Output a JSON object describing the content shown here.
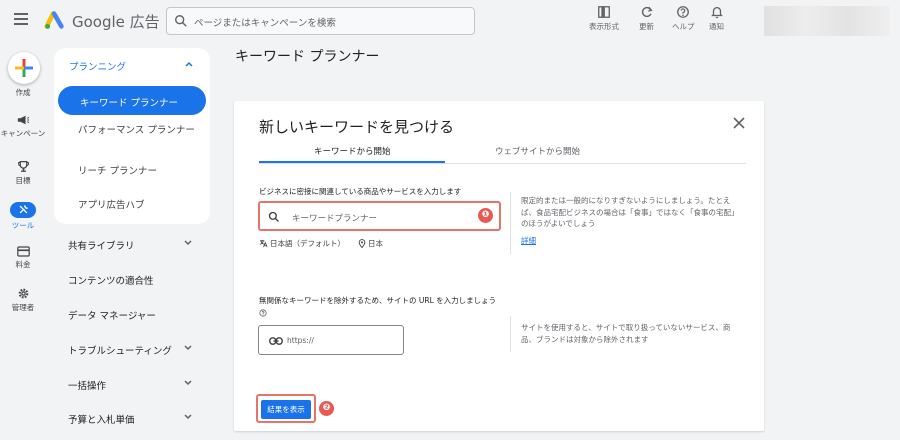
{
  "header": {
    "brand": "Google 広告",
    "search_placeholder": "ページまたはキャンペーンを検索",
    "tools": [
      {
        "label": "表示形式",
        "icon": "display-format-icon"
      },
      {
        "label": "更新",
        "icon": "refresh-icon"
      },
      {
        "label": "ヘルプ",
        "icon": "help-icon"
      },
      {
        "label": "通知",
        "icon": "bell-icon"
      }
    ]
  },
  "rail": {
    "create_label": "作成",
    "campaign_label": "キャンペーン",
    "goals_label": "目標",
    "tools_label": "ツール",
    "billing_label": "料金",
    "admin_label": "管理者"
  },
  "nav": {
    "planning_header": "プランニング",
    "items": [
      "キーワード プランナー",
      "パフォーマンス プランナー",
      "リーチ プランナー",
      "アプリ広告ハブ"
    ],
    "sections": [
      "共有ライブラリ",
      "コンテンツの適合性",
      "データ マネージャー",
      "トラブルシューティング",
      "一括操作",
      "予算と入札単価"
    ]
  },
  "page": {
    "title": "キーワード プランナー"
  },
  "card": {
    "title": "新しいキーワードを見つける",
    "tabs": [
      "キーワードから開始",
      "ウェブサイトから開始"
    ],
    "active_tab": 0,
    "keyword_label": "ビジネスに密接に関連している商品やサービスを入力します",
    "keyword_placeholder": "キーワードプランナー",
    "language": "日本語（デフォルト）",
    "location": "日本",
    "keyword_help": "限定的または一般的になりすぎないようにしましょう。たとえば、食品宅配ビジネスの場合は「食事」ではなく「食事の宅配」のほうがよいでしょう",
    "details_link": "詳細",
    "url_label": "無関係なキーワードを除外するため、サイトの URL を入力しましょう",
    "url_placeholder": "https://",
    "url_help": "サイトを使用すると、サイトで取り扱っていないサービス、商品、ブランドは対象から除外されます",
    "submit_label": "結果を表示"
  },
  "annotations": {
    "badge1": "❶",
    "badge2": "❷"
  },
  "colors": {
    "accent": "#1a73e8",
    "highlight": "#e8736b"
  }
}
